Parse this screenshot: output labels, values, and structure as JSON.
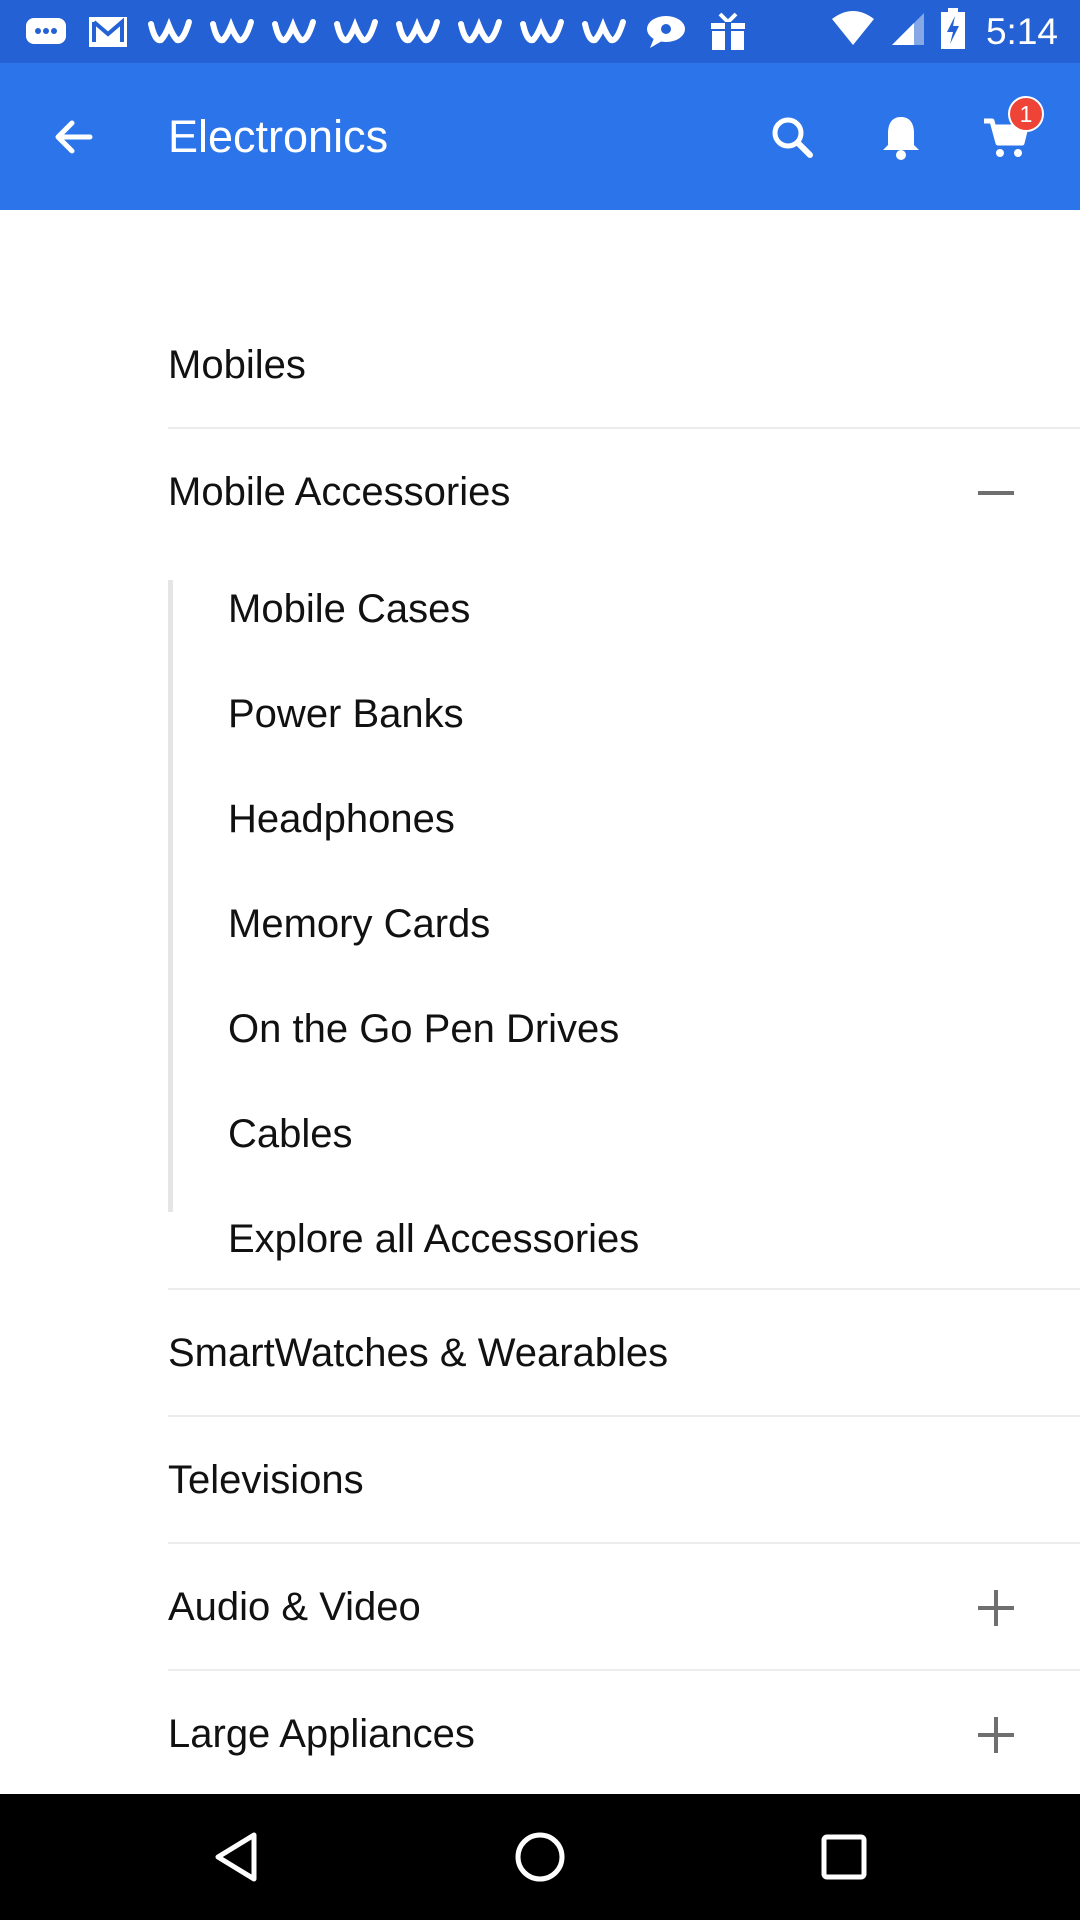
{
  "status_bar": {
    "time": "5:14",
    "notification_icons": [
      "message-icon",
      "gmail-icon",
      "w-app-icon",
      "w-app-icon",
      "w-app-icon",
      "w-app-icon",
      "w-app-icon",
      "w-app-icon",
      "w-app-icon",
      "w-app-icon",
      "chat-bubble-icon",
      "gift-box-icon"
    ],
    "system_icons": [
      "wifi-icon",
      "signal-icon",
      "battery-charging-icon"
    ]
  },
  "app_bar": {
    "title": "Electronics",
    "cart_count": "1",
    "colors": {
      "app_bar": "#2c74ea",
      "status_bar": "#2361d4",
      "badge": "#f04338"
    }
  },
  "categories": [
    {
      "label": "Mobiles",
      "toggle": "none"
    },
    {
      "label": "Mobile Accessories",
      "toggle": "collapse",
      "subitems": [
        "Mobile Cases",
        "Power Banks",
        "Headphones",
        "Memory Cards",
        "On the Go Pen Drives",
        "Cables",
        "Explore all Accessories"
      ]
    },
    {
      "label": "SmartWatches & Wearables",
      "toggle": "none"
    },
    {
      "label": "Televisions",
      "toggle": "none"
    },
    {
      "label": "Audio & Video",
      "toggle": "expand"
    },
    {
      "label": "Large Appliances",
      "toggle": "expand"
    }
  ],
  "nav_bar": [
    "back-triangle-icon",
    "home-circle-icon",
    "recents-square-icon"
  ]
}
